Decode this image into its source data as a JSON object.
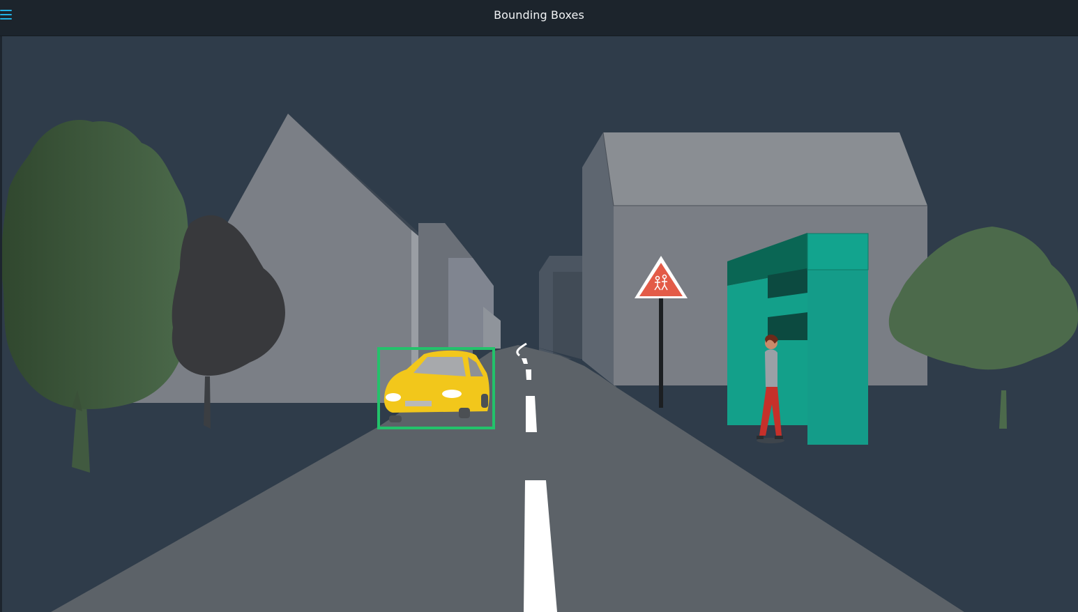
{
  "header": {
    "title": "Bounding Boxes",
    "menu_icon": "hamburger-menu-icon",
    "accent_color": "#22b2e6"
  },
  "scene": {
    "background_color": "#2f3c4a",
    "bounding_box": {
      "target": "car",
      "color": "#23c26b"
    },
    "objects": [
      "tree",
      "house",
      "road",
      "car",
      "warning-sign",
      "bus-stop",
      "pedestrian"
    ]
  }
}
